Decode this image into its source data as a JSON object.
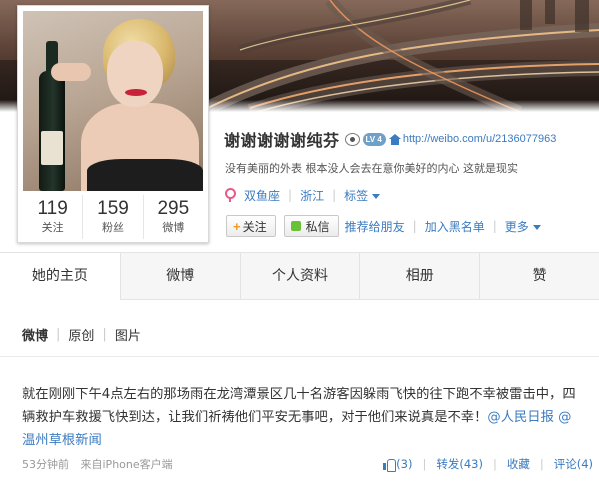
{
  "profile": {
    "name": "谢谢谢谢谢纯芬",
    "level_badge": "LV 4",
    "url": "http://weibo.com/u/2136077963",
    "bio": "没有美丽的外表 根本没人会去在意你美好的内心 这就是现实",
    "tags": {
      "constellation": "双鱼座",
      "location": "浙江",
      "tag_label": "标签"
    },
    "stats": [
      {
        "num": "119",
        "label": "关注"
      },
      {
        "num": "159",
        "label": "粉丝"
      },
      {
        "num": "295",
        "label": "微博"
      }
    ],
    "actions": {
      "follow": "关注",
      "message": "私信",
      "recommend": "推荐给朋友",
      "blacklist": "加入黑名单",
      "more": "更多"
    }
  },
  "tabs": [
    {
      "label": "她的主页",
      "active": true
    },
    {
      "label": "微博",
      "active": false
    },
    {
      "label": "个人资料",
      "active": false
    },
    {
      "label": "相册",
      "active": false
    },
    {
      "label": "赞",
      "active": false
    }
  ],
  "subtabs": [
    "微博",
    "原创",
    "图片"
  ],
  "post": {
    "text_main": "就在刚刚下午4点左右的那场雨在龙湾潭景区几十名游客因躲雨飞快的往下跑不幸被雷击中，四辆救护车救援飞快到达，让我们祈祷他们平安无事吧，对于他们来说真是不幸！",
    "mention_1": "@人民日报",
    "mention_2": "@温州草根新闻",
    "time": "53分钟前",
    "source_prefix": "来自",
    "source": "iPhone客户端",
    "likes": "(3)",
    "repost": "转发(43)",
    "favorite": "收藏",
    "comment": "评论(4)"
  },
  "colors": {
    "link": "#3b7bc0",
    "level_badge": "#6fa0c8",
    "gender": "#e55b8b",
    "follow_plus": "#f09a2b",
    "message_icon": "#67c23a"
  }
}
